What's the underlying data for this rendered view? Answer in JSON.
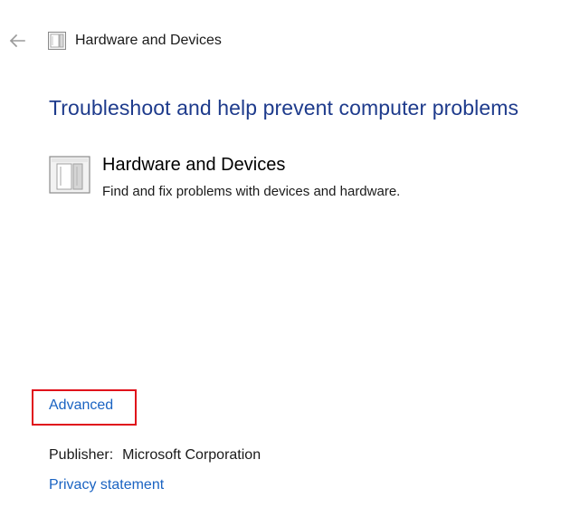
{
  "header": {
    "title": "Hardware and Devices",
    "back_icon": "back-arrow-icon",
    "title_icon": "hardware-devices-icon"
  },
  "main": {
    "heading": "Troubleshoot and help prevent computer problems",
    "item": {
      "icon": "hardware-devices-icon",
      "title": "Hardware and Devices",
      "description": "Find and fix problems with devices and hardware."
    }
  },
  "footer": {
    "advanced_label": "Advanced",
    "publisher_label": "Publisher:",
    "publisher_value": "Microsoft Corporation",
    "privacy_label": "Privacy statement"
  },
  "colors": {
    "heading": "#1e3b8c",
    "link": "#1a63c2",
    "highlight_box": "#e0111b"
  }
}
